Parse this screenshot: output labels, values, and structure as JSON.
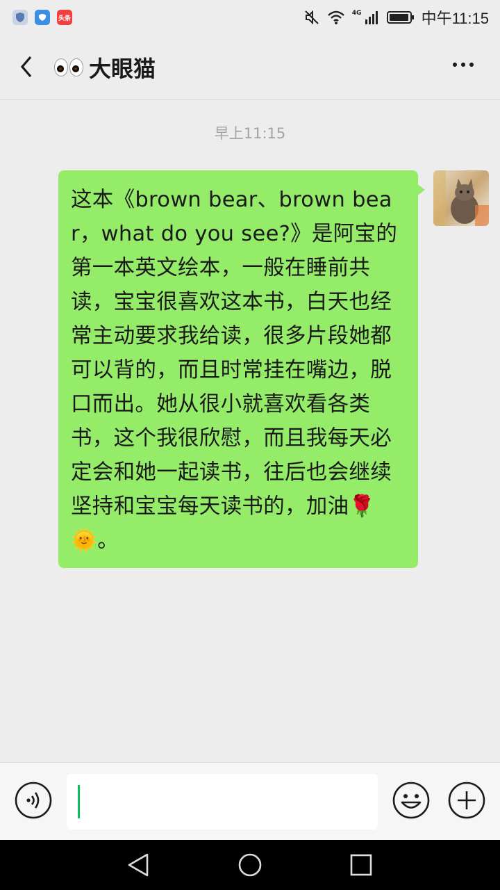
{
  "status_bar": {
    "time": "中午11:15",
    "network": "4G",
    "notif_badge_text": "头条"
  },
  "header": {
    "title": "大眼猫",
    "title_icon": "eyes-emoji"
  },
  "chat": {
    "timestamp": "早上11:15",
    "messages": [
      {
        "sender": "self",
        "text": "这本《brown bear、brown bear，what do you see?》是阿宝的第一本英文绘本，一般在睡前共读，宝宝很喜欢这本书，白天也经常主动要求我给读，很多片段她都可以背的，而且时常挂在嘴边，脱口而出。她从很小就喜欢看各类书，这个我很欣慰，而且我每天必定会和她一起读书，往后也会继续坚持和宝宝每天读书的，加油🌹🌞。"
      }
    ]
  },
  "input": {
    "value": ""
  },
  "colors": {
    "bubble_self": "#95ec69",
    "background": "#ededed",
    "accent": "#07c160"
  }
}
